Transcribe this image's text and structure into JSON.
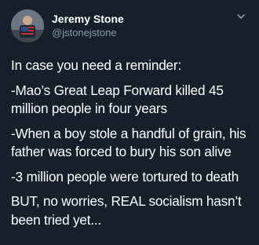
{
  "tweet": {
    "display_name": "Jeremy Stone",
    "handle": "@jstonejstone",
    "paragraphs": [
      "In case you need a reminder:",
      "-Mao’s Great Leap Forward killed 45 million people in four years",
      "-When a boy stole a handful of grain, his father was forced to bury his son alive",
      "-3 million people were tortured to death",
      "BUT, no worries, REAL socialism hasn’t been tried yet..."
    ]
  },
  "icons": {
    "menu": "chevron-down-icon"
  },
  "colors": {
    "background": "#15202b",
    "text": "#ffffff",
    "secondary_text": "#8899a6"
  }
}
